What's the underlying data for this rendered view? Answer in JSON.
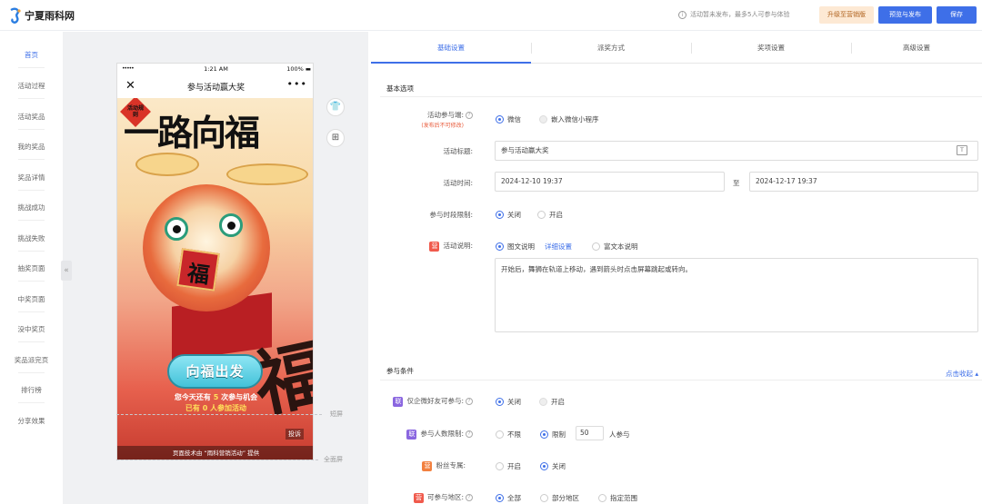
{
  "brand": {
    "name": "宁夏雨科网"
  },
  "header": {
    "notice": "活动暂未发布，最多5人可参与体验",
    "upgrade_label": "升级至营销版",
    "preview_publish_label": "预览与发布",
    "save_label": "保存"
  },
  "sidebar": {
    "items": [
      {
        "label": "首页",
        "active": true
      },
      {
        "label": "活动过程"
      },
      {
        "label": "活动奖品"
      },
      {
        "label": "我的奖品"
      },
      {
        "label": "奖品详情"
      },
      {
        "label": "挑战成功"
      },
      {
        "label": "挑战失败"
      },
      {
        "label": "抽奖页面"
      },
      {
        "label": "中奖页面"
      },
      {
        "label": "没中奖页"
      },
      {
        "label": "奖品派完页"
      },
      {
        "label": "排行榜"
      },
      {
        "label": "分享效果"
      }
    ],
    "collapse_glyph": "«"
  },
  "phone": {
    "signal": "•••••",
    "time": "1:21 AM",
    "battery": "100% ▬",
    "nav_title": "参与活动赢大奖",
    "close_glyph": "✕",
    "more_glyph": "•••",
    "stamp_text": "活动规则",
    "headline": "一路向福",
    "fu_char": "福",
    "big_char": "福",
    "cta_label": "向福出发",
    "chance_prefix": "您今天还有",
    "chance_count": "5",
    "chance_suffix": "次参与机会",
    "joined_text": "已有 0 人参加活动",
    "report_label": "投诉",
    "footer_text": "页面技术由 “雨科营销活动” 提供"
  },
  "preview_tools": {
    "theme_glyph": "👕",
    "layout_glyph": "⊞"
  },
  "screen_labels": {
    "short": "短屏",
    "full": "全面屏"
  },
  "tabs": [
    {
      "label": "基础设置",
      "active": true
    },
    {
      "label": "派奖方式"
    },
    {
      "label": "奖项设置"
    },
    {
      "label": "高级设置"
    }
  ],
  "basic": {
    "section_title": "基本选项",
    "participant_label": "活动参与端:",
    "participant_note": "(发布后不可修改)",
    "participant_options": [
      "微信",
      "嵌入微信小程序"
    ],
    "title_label": "活动标题:",
    "title_value": "参与活动赢大奖",
    "time_label": "活动时间:",
    "start_time": "2024-12-10 19:37",
    "time_sep": "至",
    "end_time": "2024-12-17 19:37",
    "period_label": "参与时段限制:",
    "period_options": [
      "关闭",
      "开启"
    ],
    "desc_badge": "营",
    "desc_label": "活动说明:",
    "desc_options": [
      "图文说明",
      "富文本说明"
    ],
    "desc_detail_link": "详细设置",
    "desc_text": "开始后，舞狮在轨道上移动，遇到箭头时点击屏幕跳起或转向。"
  },
  "conditions": {
    "section_title": "参与条件",
    "collapse_link": "点击收起 ▴",
    "friends_badge": "联",
    "friends_label": "仅企微好友可参与:",
    "friends_options": [
      "关闭",
      "开启"
    ],
    "count_badge": "联",
    "count_label": "参与人数限制:",
    "count_options": [
      "不限",
      "限制"
    ],
    "count_value": "50",
    "count_suffix": "人参与",
    "fans_badge": "营",
    "fans_label": "粉丝专属:",
    "fans_options": [
      "开启",
      "关闭"
    ],
    "region_badge": "营",
    "region_label": "可参与地区:",
    "region_options": [
      "全部",
      "部分地区",
      "指定范围"
    ]
  },
  "colors": {
    "accent": "#3e6fe8",
    "upgrade_bg": "#fde9d4",
    "badge_red": "#f05a4c",
    "badge_purple": "#8a66e0"
  }
}
